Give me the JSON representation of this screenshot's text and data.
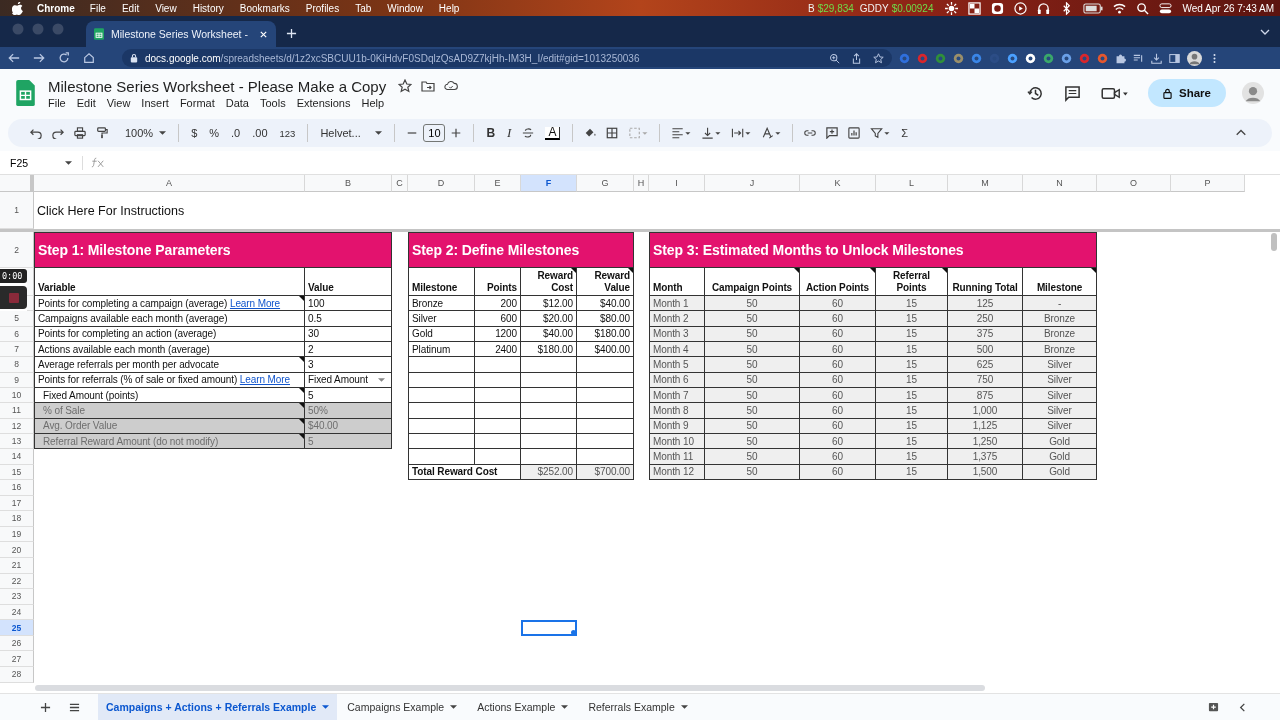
{
  "menubar": {
    "app": "Chrome",
    "menus": [
      "File",
      "Edit",
      "View",
      "History",
      "Bookmarks",
      "Profiles",
      "Tab",
      "Window",
      "Help"
    ],
    "tickers": [
      {
        "symbol": "B",
        "price": "$29,834"
      },
      {
        "symbol": "GDDY",
        "price": "$0.00924"
      }
    ],
    "clock": "Wed Apr 26  7:43 AM"
  },
  "browser": {
    "tabs": [
      {
        "title": "Milestone Series Worksheet -",
        "selected": true
      }
    ],
    "url_host": "docs.google.com",
    "url_path": "/spreadsheets/d/1z2xcSBCUU1b-0KiHdvF0SDqlzQsAD9Z7kjHh-IM3H_I/edit#gid=1013250036"
  },
  "doc": {
    "title": "Milestone Series Worksheet - Please Make a Copy",
    "menus": [
      "File",
      "Edit",
      "View",
      "Insert",
      "Format",
      "Data",
      "Tools",
      "Extensions",
      "Help"
    ],
    "share": "Share"
  },
  "toolbar": {
    "zoom": "100%",
    "currency": "$",
    "percent": "%",
    "decrease_decimals": ".0",
    "increase_decimals": ".00",
    "number_format": "123",
    "font": "Helvet...",
    "font_size": "10",
    "bold": "B",
    "italic": "I",
    "text_color": "A",
    "sum": "Σ"
  },
  "formula_bar": {
    "cell": "F25"
  },
  "recorder": {
    "time": "0:00"
  },
  "sheet": {
    "columns": [
      {
        "label": "A",
        "selected": false
      },
      {
        "label": "B",
        "selected": false
      },
      {
        "label": "C",
        "selected": false
      },
      {
        "label": "D",
        "selected": false
      },
      {
        "label": "E",
        "selected": false
      },
      {
        "label": "F",
        "selected": true
      },
      {
        "label": "G",
        "selected": false
      },
      {
        "label": "H",
        "selected": false
      },
      {
        "label": "I",
        "selected": false
      },
      {
        "label": "J",
        "selected": false
      },
      {
        "label": "K",
        "selected": false
      },
      {
        "label": "L",
        "selected": false
      },
      {
        "label": "M",
        "selected": false
      },
      {
        "label": "N",
        "selected": false
      },
      {
        "label": "O",
        "selected": false
      },
      {
        "label": "P",
        "selected": false
      }
    ],
    "rows": [
      {
        "label": "1",
        "selected": false
      },
      {
        "label": "2",
        "selected": false
      },
      {
        "selected": false
      },
      {
        "selected": false
      },
      {
        "label": "5",
        "selected": false
      },
      {
        "label": "6",
        "selected": false
      },
      {
        "label": "7",
        "selected": false
      },
      {
        "label": "8",
        "selected": false
      },
      {
        "label": "9",
        "selected": false
      },
      {
        "label": "10",
        "selected": false
      },
      {
        "label": "11",
        "selected": false
      },
      {
        "label": "12",
        "selected": false
      },
      {
        "label": "13",
        "selected": false
      },
      {
        "label": "14",
        "selected": false
      },
      {
        "label": "15",
        "selected": false
      },
      {
        "label": "16",
        "selected": false
      },
      {
        "label": "17",
        "selected": false
      },
      {
        "label": "18",
        "selected": false
      },
      {
        "label": "19",
        "selected": false
      },
      {
        "label": "20",
        "selected": false
      },
      {
        "label": "21",
        "selected": false
      },
      {
        "label": "22",
        "selected": false
      },
      {
        "label": "23",
        "selected": false
      },
      {
        "label": "24",
        "selected": false
      },
      {
        "label": "25",
        "selected": true
      },
      {
        "label": "26",
        "selected": false
      },
      {
        "label": "27",
        "selected": false
      },
      {
        "label": "28",
        "selected": false
      }
    ],
    "instructions": "Click Here For Instructions",
    "step1": {
      "title": "Step 1: Milestone Parameters",
      "headers": [
        "Variable",
        "Value"
      ],
      "rows": [
        {
          "kind": "text",
          "label": "Points for completing a campaign (average)",
          "link": "Learn More",
          "value": "100",
          "note": true,
          "disabled": false
        },
        {
          "kind": "text",
          "label": "Campaigns available each month (average)",
          "value": "0.5",
          "note": false,
          "disabled": false
        },
        {
          "kind": "text",
          "label": "Points for completing an action (average)",
          "value": "30",
          "note": false,
          "disabled": false
        },
        {
          "kind": "text",
          "label": "Actions available each month (average)",
          "value": "2",
          "note": false,
          "disabled": false
        },
        {
          "kind": "text",
          "label": "Average referrals per month per advocate",
          "value": "3",
          "note": true,
          "disabled": false
        },
        {
          "kind": "dropdown",
          "label": "Points for referrals (% of sale or fixed amount)",
          "link": "Learn More",
          "value": "Fixed Amount",
          "note": false,
          "disabled": false,
          "children": [
            {
              "label": "Fixed Amount (points)",
              "value": "5",
              "note": true,
              "disabled": false
            },
            {
              "label": "% of Sale",
              "value": "50%",
              "note": true,
              "disabled": true
            },
            {
              "label": "Avg. Order Value",
              "value": "$40.00",
              "note": true,
              "disabled": true
            },
            {
              "label": "Referral Reward Amount (do not modify)",
              "value": "5",
              "note": true,
              "disabled": true
            }
          ]
        }
      ]
    },
    "step2": {
      "title": "Step 2: Define Milestones",
      "headers": [
        {
          "text": "Milestone",
          "note": false
        },
        {
          "text": "Points",
          "note": false
        },
        {
          "text": "Reward Cost",
          "note": true
        },
        {
          "text": "Reward Value",
          "note": true
        }
      ],
      "rows": [
        [
          "Bronze",
          "200",
          "$12.00",
          "$40.00"
        ],
        [
          "Silver",
          "600",
          "$20.00",
          "$80.00"
        ],
        [
          "Gold",
          "1200",
          "$40.00",
          "$180.00"
        ],
        [
          "Platinum",
          "2400",
          "$180.00",
          "$400.00"
        ]
      ],
      "total": {
        "label": "Total Reward Cost",
        "cost": "$252.00",
        "value": "$700.00"
      }
    },
    "step3": {
      "title": "Step 3: Estimated Months to Unlock Milestones",
      "headers": [
        {
          "text": "Month",
          "note": false
        },
        {
          "text": "Campaign Points",
          "note": true
        },
        {
          "text": "Action Points",
          "note": true
        },
        {
          "text": "Referral Points",
          "note": true
        },
        {
          "text": "Running Total",
          "note": false
        },
        {
          "text": "Milestone",
          "note": true
        }
      ],
      "rows": [
        [
          "Month 1",
          "50",
          "60",
          "15",
          "125",
          "-"
        ],
        [
          "Month 2",
          "50",
          "60",
          "15",
          "250",
          "Bronze"
        ],
        [
          "Month 3",
          "50",
          "60",
          "15",
          "375",
          "Bronze"
        ],
        [
          "Month 4",
          "50",
          "60",
          "15",
          "500",
          "Bronze"
        ],
        [
          "Month 5",
          "50",
          "60",
          "15",
          "625",
          "Silver"
        ],
        [
          "Month 6",
          "50",
          "60",
          "15",
          "750",
          "Silver"
        ],
        [
          "Month 7",
          "50",
          "60",
          "15",
          "875",
          "Silver"
        ],
        [
          "Month 8",
          "50",
          "60",
          "15",
          "1,000",
          "Silver"
        ],
        [
          "Month 9",
          "50",
          "60",
          "15",
          "1,125",
          "Silver"
        ],
        [
          "Month 10",
          "50",
          "60",
          "15",
          "1,250",
          "Gold"
        ],
        [
          "Month 11",
          "50",
          "60",
          "15",
          "1,375",
          "Gold"
        ],
        [
          "Month 12",
          "50",
          "60",
          "15",
          "1,500",
          "Gold"
        ]
      ]
    }
  },
  "sheet_tabs": [
    {
      "label": "Campaigns + Actions + Referrals Example",
      "selected": true
    },
    {
      "label": "Campaigns Example",
      "selected": false
    },
    {
      "label": "Actions Example",
      "selected": false
    },
    {
      "label": "Referrals Example",
      "selected": false
    }
  ]
}
